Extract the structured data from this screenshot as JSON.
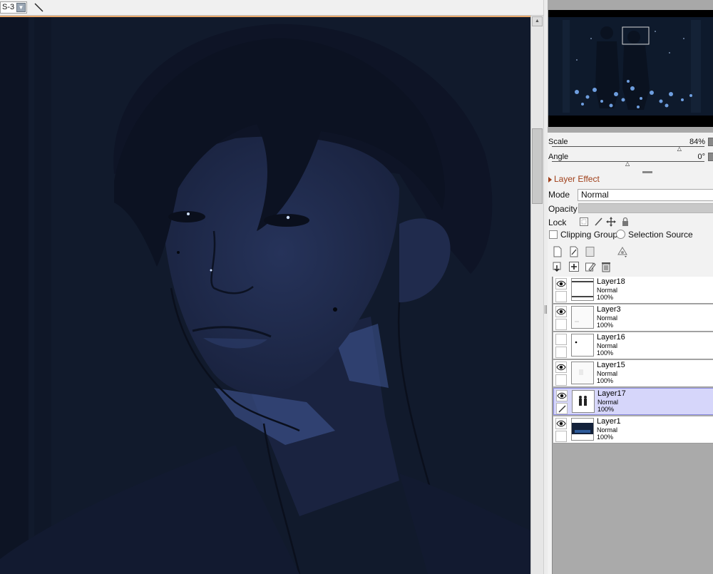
{
  "toolbar": {
    "brush_preset": "S-3",
    "brush_dropdown_icon": "chevron-down-icon",
    "line_tool_icon": "line-tool-icon"
  },
  "canvas": {
    "description_icon": "artwork-canvas",
    "background_color": "#111a2c"
  },
  "navigator": {
    "scale_label": "Scale",
    "scale_value": "84%",
    "scale_fraction": 0.84,
    "angle_label": "Angle",
    "angle_value": "0°",
    "angle_fraction": 0.5
  },
  "layer_panel": {
    "layer_effect_label": "Layer Effect",
    "mode_label": "Mode",
    "mode_value": "Normal",
    "opacity_label": "Opacity",
    "lock_label": "Lock",
    "lock_icons": [
      "lock-transparency-icon",
      "lock-paint-icon",
      "lock-move-icon",
      "lock-all-icon"
    ],
    "clipping_group_label": "Clipping Group",
    "selection_source_label": "Selection Source",
    "action_icons_row1": [
      "new-layer-icon",
      "new-linework-layer-icon",
      "new-folder-icon",
      "layer-filter-icon"
    ],
    "action_icons_row2": [
      "transfer-down-icon",
      "merge-down-icon",
      "clear-layer-icon",
      "delete-layer-icon"
    ]
  },
  "layers": [
    {
      "name": "Layer18",
      "mode": "Normal",
      "opacity": "100%",
      "visible": true,
      "selected": false,
      "thumb": "white-lines"
    },
    {
      "name": "Layer3",
      "mode": "Normal",
      "opacity": "100%",
      "visible": true,
      "selected": false,
      "thumb": "white"
    },
    {
      "name": "Layer16",
      "mode": "Normal",
      "opacity": "100%",
      "visible": false,
      "selected": false,
      "thumb": "dot"
    },
    {
      "name": "Layer15",
      "mode": "Normal",
      "opacity": "100%",
      "visible": true,
      "selected": false,
      "thumb": "faint"
    },
    {
      "name": "Layer17",
      "mode": "Normal",
      "opacity": "100%",
      "visible": true,
      "selected": true,
      "thumb": "figures"
    },
    {
      "name": "Layer1",
      "mode": "Normal",
      "opacity": "100%",
      "visible": true,
      "selected": false,
      "thumb": "dark"
    }
  ],
  "colors": {
    "accent_orange": "#e8a86a",
    "selected_layer": "#d6d6fa",
    "layer_effect_text": "#a0401a"
  }
}
